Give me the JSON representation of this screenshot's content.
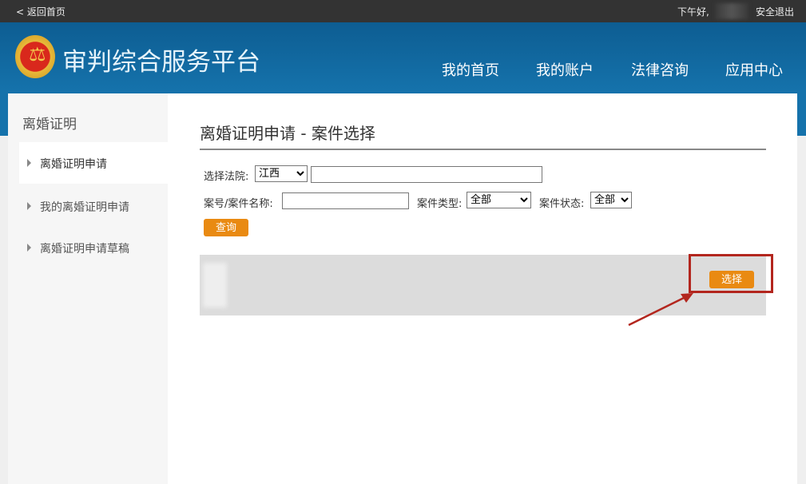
{
  "topbar": {
    "back": "< 返回首页",
    "greeting": "下午好,",
    "logout": "安全退出"
  },
  "header": {
    "title": "审判综合服务平台",
    "logo_glyph": "⚖",
    "nav": [
      "我的首页",
      "我的账户",
      "法律咨询",
      "应用中心"
    ]
  },
  "sidebar": {
    "heading": "离婚证明",
    "items": [
      {
        "label": "离婚证明申请",
        "active": true
      },
      {
        "label": "我的离婚证明申请"
      },
      {
        "label": "离婚证明申请草稿"
      }
    ]
  },
  "main": {
    "title": "离婚证明申请 - 案件选择",
    "court_label": "选择法院:",
    "court_select": "江西",
    "court_input": "",
    "case_label": "案号/案件名称:",
    "case_input": "",
    "type_label": "案件类型:",
    "type_select": "全部",
    "status_label": "案件状态:",
    "status_select": "全部",
    "query_button": "查询",
    "select_button": "选择"
  },
  "colors": {
    "accent": "#e98a12",
    "header": "#1572ab",
    "highlight": "#b3261e"
  }
}
